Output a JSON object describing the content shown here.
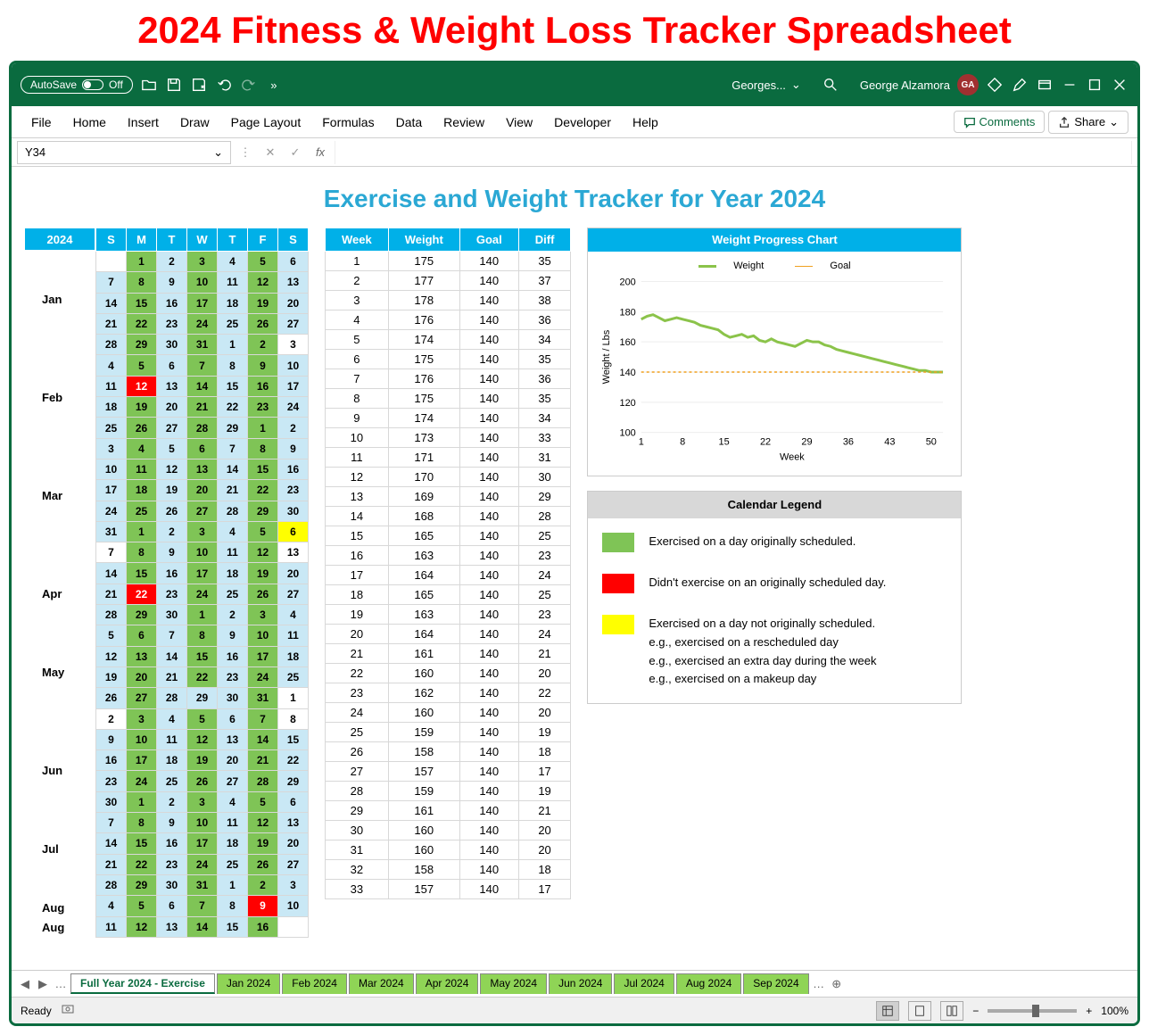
{
  "page_title": "2024 Fitness & Weight Loss Tracker Spreadsheet",
  "titlebar": {
    "autosave_label": "AutoSave",
    "autosave_state": "Off",
    "doc_name": "Georges...",
    "user_name": "George Alzamora",
    "user_initials": "GA"
  },
  "ribbon": {
    "tabs": [
      "File",
      "Home",
      "Insert",
      "Draw",
      "Page Layout",
      "Formulas",
      "Data",
      "Review",
      "View",
      "Developer",
      "Help"
    ],
    "comments": "Comments",
    "share": "Share"
  },
  "formula_bar": {
    "cell_ref": "Y34",
    "fx": "fx",
    "value": ""
  },
  "sheet": {
    "title": "Exercise and Weight Tracker for Year 2024",
    "year": "2024",
    "day_headers": [
      "S",
      "M",
      "T",
      "W",
      "T",
      "F",
      "S"
    ],
    "months": [
      "Jan",
      "Feb",
      "Mar",
      "Apr",
      "May",
      "Jun",
      "Jul",
      "Aug"
    ],
    "month_row_spans": [
      5,
      5,
      5,
      4,
      5,
      4,
      5,
      2
    ],
    "calendar": [
      [
        [
          "",
          "b"
        ],
        [
          "1",
          "d"
        ],
        [
          "2",
          "s"
        ],
        [
          "3",
          "d"
        ],
        [
          "4",
          "s"
        ],
        [
          "5",
          "d"
        ],
        [
          "6",
          "s"
        ]
      ],
      [
        [
          "7",
          "s"
        ],
        [
          "8",
          "d"
        ],
        [
          "9",
          "s"
        ],
        [
          "10",
          "d"
        ],
        [
          "11",
          "s"
        ],
        [
          "12",
          "d"
        ],
        [
          "13",
          "s"
        ]
      ],
      [
        [
          "14",
          "s"
        ],
        [
          "15",
          "d"
        ],
        [
          "16",
          "s"
        ],
        [
          "17",
          "d"
        ],
        [
          "18",
          "s"
        ],
        [
          "19",
          "d"
        ],
        [
          "20",
          "s"
        ]
      ],
      [
        [
          "21",
          "s"
        ],
        [
          "22",
          "d"
        ],
        [
          "23",
          "s"
        ],
        [
          "24",
          "d"
        ],
        [
          "25",
          "s"
        ],
        [
          "26",
          "d"
        ],
        [
          "27",
          "s"
        ]
      ],
      [
        [
          "28",
          "s"
        ],
        [
          "29",
          "d"
        ],
        [
          "30",
          "s"
        ],
        [
          "31",
          "d"
        ],
        [
          "1",
          "s"
        ],
        [
          "2",
          "d"
        ],
        [
          "3",
          "b"
        ]
      ],
      [
        [
          "4",
          "s"
        ],
        [
          "5",
          "d"
        ],
        [
          "6",
          "s"
        ],
        [
          "7",
          "d"
        ],
        [
          "8",
          "s"
        ],
        [
          "9",
          "d"
        ],
        [
          "10",
          "s"
        ]
      ],
      [
        [
          "11",
          "s"
        ],
        [
          "12",
          "m"
        ],
        [
          "13",
          "s"
        ],
        [
          "14",
          "d"
        ],
        [
          "15",
          "s"
        ],
        [
          "16",
          "d"
        ],
        [
          "17",
          "s"
        ]
      ],
      [
        [
          "18",
          "s"
        ],
        [
          "19",
          "d"
        ],
        [
          "20",
          "s"
        ],
        [
          "21",
          "d"
        ],
        [
          "22",
          "s"
        ],
        [
          "23",
          "d"
        ],
        [
          "24",
          "s"
        ]
      ],
      [
        [
          "25",
          "s"
        ],
        [
          "26",
          "d"
        ],
        [
          "27",
          "s"
        ],
        [
          "28",
          "d"
        ],
        [
          "29",
          "s"
        ],
        [
          "1",
          "d"
        ],
        [
          "2",
          "s"
        ]
      ],
      [
        [
          "3",
          "s"
        ],
        [
          "4",
          "d"
        ],
        [
          "5",
          "s"
        ],
        [
          "6",
          "d"
        ],
        [
          "7",
          "s"
        ],
        [
          "8",
          "d"
        ],
        [
          "9",
          "s"
        ]
      ],
      [
        [
          "10",
          "s"
        ],
        [
          "11",
          "d"
        ],
        [
          "12",
          "s"
        ],
        [
          "13",
          "d"
        ],
        [
          "14",
          "s"
        ],
        [
          "15",
          "d"
        ],
        [
          "16",
          "s"
        ]
      ],
      [
        [
          "17",
          "s"
        ],
        [
          "18",
          "d"
        ],
        [
          "19",
          "s"
        ],
        [
          "20",
          "d"
        ],
        [
          "21",
          "s"
        ],
        [
          "22",
          "d"
        ],
        [
          "23",
          "s"
        ]
      ],
      [
        [
          "24",
          "s"
        ],
        [
          "25",
          "d"
        ],
        [
          "26",
          "s"
        ],
        [
          "27",
          "d"
        ],
        [
          "28",
          "s"
        ],
        [
          "29",
          "d"
        ],
        [
          "30",
          "s"
        ]
      ],
      [
        [
          "31",
          "s"
        ],
        [
          "1",
          "d"
        ],
        [
          "2",
          "s"
        ],
        [
          "3",
          "d"
        ],
        [
          "4",
          "s"
        ],
        [
          "5",
          "d"
        ],
        [
          "6",
          "e"
        ]
      ],
      [
        [
          "7",
          "b"
        ],
        [
          "8",
          "d"
        ],
        [
          "9",
          "s"
        ],
        [
          "10",
          "d"
        ],
        [
          "11",
          "s"
        ],
        [
          "12",
          "d"
        ],
        [
          "13",
          "b"
        ]
      ],
      [
        [
          "14",
          "s"
        ],
        [
          "15",
          "d"
        ],
        [
          "16",
          "s"
        ],
        [
          "17",
          "d"
        ],
        [
          "18",
          "s"
        ],
        [
          "19",
          "d"
        ],
        [
          "20",
          "s"
        ]
      ],
      [
        [
          "21",
          "s"
        ],
        [
          "22",
          "m"
        ],
        [
          "23",
          "s"
        ],
        [
          "24",
          "d"
        ],
        [
          "25",
          "s"
        ],
        [
          "26",
          "d"
        ],
        [
          "27",
          "s"
        ]
      ],
      [
        [
          "28",
          "s"
        ],
        [
          "29",
          "d"
        ],
        [
          "30",
          "s"
        ],
        [
          "1",
          "d"
        ],
        [
          "2",
          "s"
        ],
        [
          "3",
          "d"
        ],
        [
          "4",
          "s"
        ]
      ],
      [
        [
          "5",
          "s"
        ],
        [
          "6",
          "d"
        ],
        [
          "7",
          "s"
        ],
        [
          "8",
          "d"
        ],
        [
          "9",
          "s"
        ],
        [
          "10",
          "d"
        ],
        [
          "11",
          "s"
        ]
      ],
      [
        [
          "12",
          "s"
        ],
        [
          "13",
          "d"
        ],
        [
          "14",
          "s"
        ],
        [
          "15",
          "d"
        ],
        [
          "16",
          "s"
        ],
        [
          "17",
          "d"
        ],
        [
          "18",
          "s"
        ]
      ],
      [
        [
          "19",
          "s"
        ],
        [
          "20",
          "d"
        ],
        [
          "21",
          "s"
        ],
        [
          "22",
          "d"
        ],
        [
          "23",
          "s"
        ],
        [
          "24",
          "d"
        ],
        [
          "25",
          "s"
        ]
      ],
      [
        [
          "26",
          "s"
        ],
        [
          "27",
          "d"
        ],
        [
          "28",
          "s"
        ],
        [
          "29",
          "s"
        ],
        [
          "30",
          "s"
        ],
        [
          "31",
          "d"
        ],
        [
          "1",
          "b"
        ]
      ],
      [
        [
          "2",
          "b"
        ],
        [
          "3",
          "d"
        ],
        [
          "4",
          "s"
        ],
        [
          "5",
          "d"
        ],
        [
          "6",
          "s"
        ],
        [
          "7",
          "d"
        ],
        [
          "8",
          "b"
        ]
      ],
      [
        [
          "9",
          "s"
        ],
        [
          "10",
          "d"
        ],
        [
          "11",
          "s"
        ],
        [
          "12",
          "d"
        ],
        [
          "13",
          "s"
        ],
        [
          "14",
          "d"
        ],
        [
          "15",
          "s"
        ]
      ],
      [
        [
          "16",
          "s"
        ],
        [
          "17",
          "d"
        ],
        [
          "18",
          "s"
        ],
        [
          "19",
          "d"
        ],
        [
          "20",
          "s"
        ],
        [
          "21",
          "d"
        ],
        [
          "22",
          "s"
        ]
      ],
      [
        [
          "23",
          "s"
        ],
        [
          "24",
          "d"
        ],
        [
          "25",
          "s"
        ],
        [
          "26",
          "d"
        ],
        [
          "27",
          "s"
        ],
        [
          "28",
          "d"
        ],
        [
          "29",
          "s"
        ]
      ],
      [
        [
          "30",
          "s"
        ],
        [
          "1",
          "d"
        ],
        [
          "2",
          "s"
        ],
        [
          "3",
          "d"
        ],
        [
          "4",
          "s"
        ],
        [
          "5",
          "d"
        ],
        [
          "6",
          "s"
        ]
      ],
      [
        [
          "7",
          "s"
        ],
        [
          "8",
          "d"
        ],
        [
          "9",
          "s"
        ],
        [
          "10",
          "d"
        ],
        [
          "11",
          "s"
        ],
        [
          "12",
          "d"
        ],
        [
          "13",
          "s"
        ]
      ],
      [
        [
          "14",
          "s"
        ],
        [
          "15",
          "d"
        ],
        [
          "16",
          "s"
        ],
        [
          "17",
          "d"
        ],
        [
          "18",
          "s"
        ],
        [
          "19",
          "d"
        ],
        [
          "20",
          "s"
        ]
      ],
      [
        [
          "21",
          "s"
        ],
        [
          "22",
          "d"
        ],
        [
          "23",
          "s"
        ],
        [
          "24",
          "d"
        ],
        [
          "25",
          "s"
        ],
        [
          "26",
          "d"
        ],
        [
          "27",
          "s"
        ]
      ],
      [
        [
          "28",
          "s"
        ],
        [
          "29",
          "d"
        ],
        [
          "30",
          "s"
        ],
        [
          "31",
          "d"
        ],
        [
          "1",
          "s"
        ],
        [
          "2",
          "d"
        ],
        [
          "3",
          "s"
        ]
      ],
      [
        [
          "4",
          "s"
        ],
        [
          "5",
          "d"
        ],
        [
          "6",
          "s"
        ],
        [
          "7",
          "d"
        ],
        [
          "8",
          "s"
        ],
        [
          "9",
          "m"
        ],
        [
          "10",
          "s"
        ]
      ],
      [
        [
          "11",
          "s"
        ],
        [
          "12",
          "d"
        ],
        [
          "13",
          "s"
        ],
        [
          "14",
          "d"
        ],
        [
          "15",
          "s"
        ],
        [
          "16",
          "d"
        ],
        [
          "",
          "b"
        ]
      ]
    ],
    "weight_headers": [
      "Week",
      "Weight",
      "Goal",
      "Diff"
    ],
    "weight_rows": [
      [
        1,
        175,
        140,
        35
      ],
      [
        2,
        177,
        140,
        37
      ],
      [
        3,
        178,
        140,
        38
      ],
      [
        4,
        176,
        140,
        36
      ],
      [
        5,
        174,
        140,
        34
      ],
      [
        6,
        175,
        140,
        35
      ],
      [
        7,
        176,
        140,
        36
      ],
      [
        8,
        175,
        140,
        35
      ],
      [
        9,
        174,
        140,
        34
      ],
      [
        10,
        173,
        140,
        33
      ],
      [
        11,
        171,
        140,
        31
      ],
      [
        12,
        170,
        140,
        30
      ],
      [
        13,
        169,
        140,
        29
      ],
      [
        14,
        168,
        140,
        28
      ],
      [
        15,
        165,
        140,
        25
      ],
      [
        16,
        163,
        140,
        23
      ],
      [
        17,
        164,
        140,
        24
      ],
      [
        18,
        165,
        140,
        25
      ],
      [
        19,
        163,
        140,
        23
      ],
      [
        20,
        164,
        140,
        24
      ],
      [
        21,
        161,
        140,
        21
      ],
      [
        22,
        160,
        140,
        20
      ],
      [
        23,
        162,
        140,
        22
      ],
      [
        24,
        160,
        140,
        20
      ],
      [
        25,
        159,
        140,
        19
      ],
      [
        26,
        158,
        140,
        18
      ],
      [
        27,
        157,
        140,
        17
      ],
      [
        28,
        159,
        140,
        19
      ],
      [
        29,
        161,
        140,
        21
      ],
      [
        30,
        160,
        140,
        20
      ],
      [
        31,
        160,
        140,
        20
      ],
      [
        32,
        158,
        140,
        18
      ],
      [
        33,
        157,
        140,
        17
      ]
    ]
  },
  "chart": {
    "title": "Weight Progress Chart",
    "legend_weight": "Weight",
    "legend_goal": "Goal",
    "y_label": "Weight / Lbs",
    "x_label": "Week"
  },
  "chart_data": {
    "type": "line",
    "title": "Weight Progress Chart",
    "xlabel": "Week",
    "ylabel": "Weight / Lbs",
    "ylim": [
      100,
      200
    ],
    "x_ticks": [
      1,
      8,
      15,
      22,
      29,
      36,
      43,
      50
    ],
    "y_ticks": [
      100,
      120,
      140,
      160,
      180,
      200
    ],
    "x": [
      1,
      2,
      3,
      4,
      5,
      6,
      7,
      8,
      9,
      10,
      11,
      12,
      13,
      14,
      15,
      16,
      17,
      18,
      19,
      20,
      21,
      22,
      23,
      24,
      25,
      26,
      27,
      28,
      29,
      30,
      31,
      32,
      33,
      34,
      35,
      36,
      37,
      38,
      39,
      40,
      41,
      42,
      43,
      44,
      45,
      46,
      47,
      48,
      49,
      50,
      51,
      52
    ],
    "series": [
      {
        "name": "Weight",
        "color": "#8bc34a",
        "values": [
          175,
          177,
          178,
          176,
          174,
          175,
          176,
          175,
          174,
          173,
          171,
          170,
          169,
          168,
          165,
          163,
          164,
          165,
          163,
          164,
          161,
          160,
          162,
          160,
          159,
          158,
          157,
          159,
          161,
          160,
          160,
          158,
          157,
          155,
          154,
          153,
          152,
          151,
          150,
          149,
          148,
          147,
          146,
          145,
          144,
          143,
          142,
          141,
          141,
          140,
          140,
          140
        ]
      },
      {
        "name": "Goal",
        "color": "#f0a020",
        "style": "dashed",
        "values": [
          140,
          140,
          140,
          140,
          140,
          140,
          140,
          140,
          140,
          140,
          140,
          140,
          140,
          140,
          140,
          140,
          140,
          140,
          140,
          140,
          140,
          140,
          140,
          140,
          140,
          140,
          140,
          140,
          140,
          140,
          140,
          140,
          140,
          140,
          140,
          140,
          140,
          140,
          140,
          140,
          140,
          140,
          140,
          140,
          140,
          140,
          140,
          140,
          140,
          140,
          140,
          140
        ]
      }
    ]
  },
  "legend": {
    "title": "Calendar Legend",
    "items": [
      {
        "color": "#7fc456",
        "text": "Exercised on a day originally scheduled."
      },
      {
        "color": "#ff0000",
        "text": "Didn't exercise on an originally scheduled day."
      },
      {
        "color": "#ffff00",
        "text": "Exercised on a day not originally scheduled.",
        "sub": [
          "e.g., exercised on a rescheduled day",
          "e.g., exercised an extra day during the week",
          "e.g., exercised on a makeup day"
        ]
      }
    ]
  },
  "sheet_tabs": [
    "Full Year 2024 - Exercise",
    "Jan 2024",
    "Feb 2024",
    "Mar 2024",
    "Apr 2024",
    "May 2024",
    "Jun 2024",
    "Jul 2024",
    "Aug 2024",
    "Sep 2024"
  ],
  "status": {
    "ready": "Ready",
    "zoom": "100%"
  }
}
